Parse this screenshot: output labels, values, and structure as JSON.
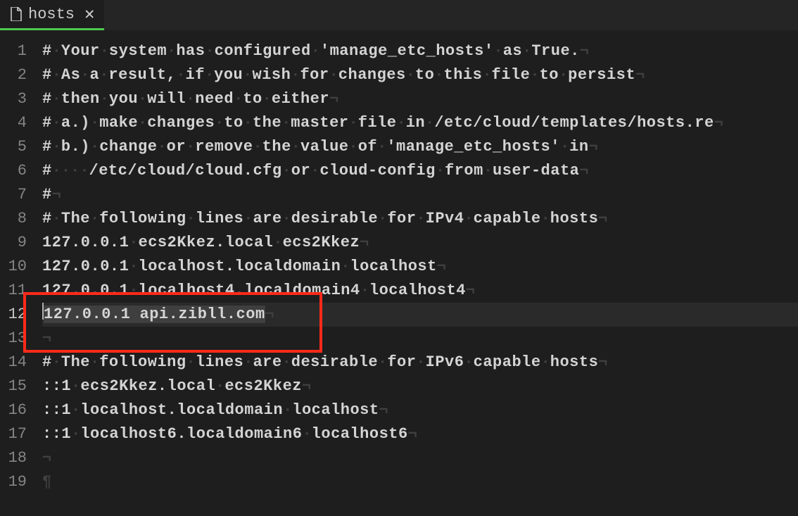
{
  "tab": {
    "filename": "hosts",
    "modified": true
  },
  "editor": {
    "current_line": 12,
    "lines": [
      {
        "n": 1,
        "tokens": [
          "#",
          "Your",
          "system",
          "has",
          "configured",
          "'manage_etc_hosts'",
          "as",
          "True."
        ]
      },
      {
        "n": 2,
        "tokens": [
          "#",
          "As",
          "a",
          "result,",
          "if",
          "you",
          "wish",
          "for",
          "changes",
          "to",
          "this",
          "file",
          "to",
          "persist"
        ]
      },
      {
        "n": 3,
        "tokens": [
          "#",
          "then",
          "you",
          "will",
          "need",
          "to",
          "either"
        ]
      },
      {
        "n": 4,
        "tokens": [
          "#",
          "a.)",
          "make",
          "changes",
          "to",
          "the",
          "master",
          "file",
          "in",
          "/etc/cloud/templates/hosts.re"
        ]
      },
      {
        "n": 5,
        "tokens": [
          "#",
          "b.)",
          "change",
          "or",
          "remove",
          "the",
          "value",
          "of",
          "'manage_etc_hosts'",
          "in"
        ]
      },
      {
        "n": 6,
        "indent": 4,
        "tokens": [
          "#",
          "/etc/cloud/cloud.cfg",
          "or",
          "cloud-config",
          "from",
          "user-data"
        ]
      },
      {
        "n": 7,
        "tokens": [
          "#"
        ]
      },
      {
        "n": 8,
        "tokens": [
          "#",
          "The",
          "following",
          "lines",
          "are",
          "desirable",
          "for",
          "IPv4",
          "capable",
          "hosts"
        ]
      },
      {
        "n": 9,
        "tokens": [
          "127.0.0.1",
          "ecs2Kkez.local",
          "ecs2Kkez"
        ]
      },
      {
        "n": 10,
        "tokens": [
          "127.0.0.1",
          "localhost.localdomain",
          "localhost"
        ]
      },
      {
        "n": 11,
        "tokens": [
          "127.0.0.1",
          "localhost4.localdomain4",
          "localhost4"
        ]
      },
      {
        "n": 12,
        "tokens": [
          "127.0.0.1",
          "api.zibll.com"
        ],
        "selected": true
      },
      {
        "n": 13,
        "tokens": []
      },
      {
        "n": 14,
        "tokens": [
          "#",
          "The",
          "following",
          "lines",
          "are",
          "desirable",
          "for",
          "IPv6",
          "capable",
          "hosts"
        ]
      },
      {
        "n": 15,
        "tokens": [
          "::1",
          "ecs2Kkez.local",
          "ecs2Kkez"
        ]
      },
      {
        "n": 16,
        "tokens": [
          "::1",
          "localhost.localdomain",
          "localhost"
        ]
      },
      {
        "n": 17,
        "tokens": [
          "::1",
          "localhost6.localdomain6",
          "localhost6"
        ]
      },
      {
        "n": 18,
        "tokens": []
      },
      {
        "n": 19,
        "tokens": [],
        "eof": true
      }
    ],
    "whitespace_glyphs": {
      "space": "·",
      "newline": "¬",
      "eof": "¶"
    }
  }
}
